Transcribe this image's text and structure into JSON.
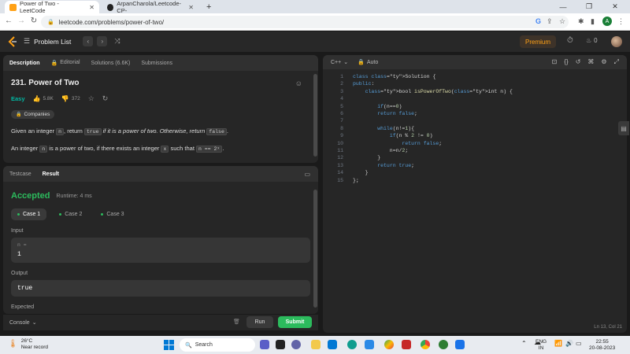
{
  "browser": {
    "tabs": [
      {
        "title": "Power of Two - LeetCode",
        "active": true
      },
      {
        "title": "ArpanCharola/Leetcode-CP-",
        "active": false
      }
    ],
    "new_tab": "+",
    "url": "leetcode.com/problems/power-of-two/",
    "profile_initial": "A"
  },
  "lc_nav": {
    "problem_list": "Problem List",
    "premium": "Premium",
    "streak_count": "0"
  },
  "description_panel": {
    "tabs": [
      "Description",
      "Editorial",
      "Solutions (6.6K)",
      "Submissions"
    ],
    "title": "231. Power of Two",
    "difficulty": "Easy",
    "likes": "5.8K",
    "dislikes": "372",
    "companies": "Companies",
    "text1_a": "Given an integer",
    "text1_code": "n",
    "text1_b": ", return",
    "text1_code2": "true",
    "text1_c": "if it is a power of two. Otherwise, return",
    "text1_code3": "false",
    "text1_d": ".",
    "text2_a": "An integer",
    "text2_code": "n",
    "text2_b": "is a power of two, if there exists an integer",
    "text2_code2": "x",
    "text2_c": "such that",
    "text2_code3": "n == 2ˣ",
    "text2_d": "."
  },
  "result_panel": {
    "tabs": [
      "Testcase",
      "Result"
    ],
    "status": "Accepted",
    "runtime": "Runtime: 4 ms",
    "cases": [
      "Case 1",
      "Case 2",
      "Case 3"
    ],
    "input_label": "Input",
    "input_var": "n =",
    "input_value": "1",
    "output_label": "Output",
    "output_value": "true",
    "expected_label": "Expected"
  },
  "console": {
    "label": "Console",
    "run": "Run",
    "submit": "Submit"
  },
  "editor": {
    "language": "C++",
    "mode": "Auto",
    "cursor": "Ln 13, Col 21",
    "lines": [
      "class Solution {",
      "public:",
      "    bool isPowerOfTwo(int n) {",
      "",
      "        if(n==0)",
      "        return false;",
      "",
      "        while(n!=1){",
      "            if(n % 2 != 0)",
      "                return false;",
      "            n=n/2;",
      "        }",
      "        return true;",
      "    }",
      "};"
    ]
  },
  "taskbar": {
    "temperature": "26°C",
    "weather": "Near record",
    "search": "Search",
    "lang1": "ENG",
    "lang2": "IN",
    "time": "22:55",
    "date": "20-08-2023"
  }
}
